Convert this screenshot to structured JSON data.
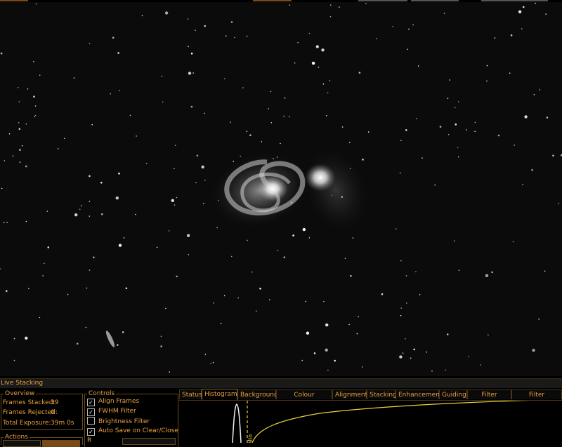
{
  "window": {
    "panel_title": "Live Stacking"
  },
  "overview": {
    "title": "Overview",
    "frames_stacked_label": "Frames Stacked:",
    "frames_stacked_value": "39",
    "frames_rejected_label": "Frames Rejected:",
    "frames_rejected_value": "0",
    "total_exposure_label": "Total Exposure:",
    "total_exposure_value": "39m 0s"
  },
  "actions": {
    "title": "Actions"
  },
  "controls": {
    "title": "Controls",
    "align_frames": {
      "label": "Align Frames",
      "checked": true
    },
    "fwhm_filter": {
      "label": "FWHM Filter",
      "checked": true
    },
    "brightness_filter": {
      "label": "Brightness Filter",
      "checked": false
    },
    "auto_save": {
      "label": "Auto Save on Clear/Close",
      "checked": true
    },
    "partial_label": "R"
  },
  "tabs": [
    {
      "label": "Status",
      "active": false
    },
    {
      "label": "Histogram",
      "active": true
    },
    {
      "label": "Background",
      "active": false
    },
    {
      "label": "Colour Calibration",
      "active": false
    },
    {
      "label": "Alignment",
      "active": false
    },
    {
      "label": "Stacking",
      "active": false
    },
    {
      "label": "Enhancement",
      "active": false
    },
    {
      "label": "Guiding",
      "active": false
    },
    {
      "label": "Filter (FWHM)",
      "active": false
    },
    {
      "label": "Filter (Brightness)",
      "active": false
    }
  ],
  "histogram": {
    "marker_label": "Min",
    "curve_color": "#e8d23a",
    "marker_color": "#e8d23a"
  },
  "colors": {
    "accent": "#e8a040",
    "border": "#6a4a1c"
  }
}
